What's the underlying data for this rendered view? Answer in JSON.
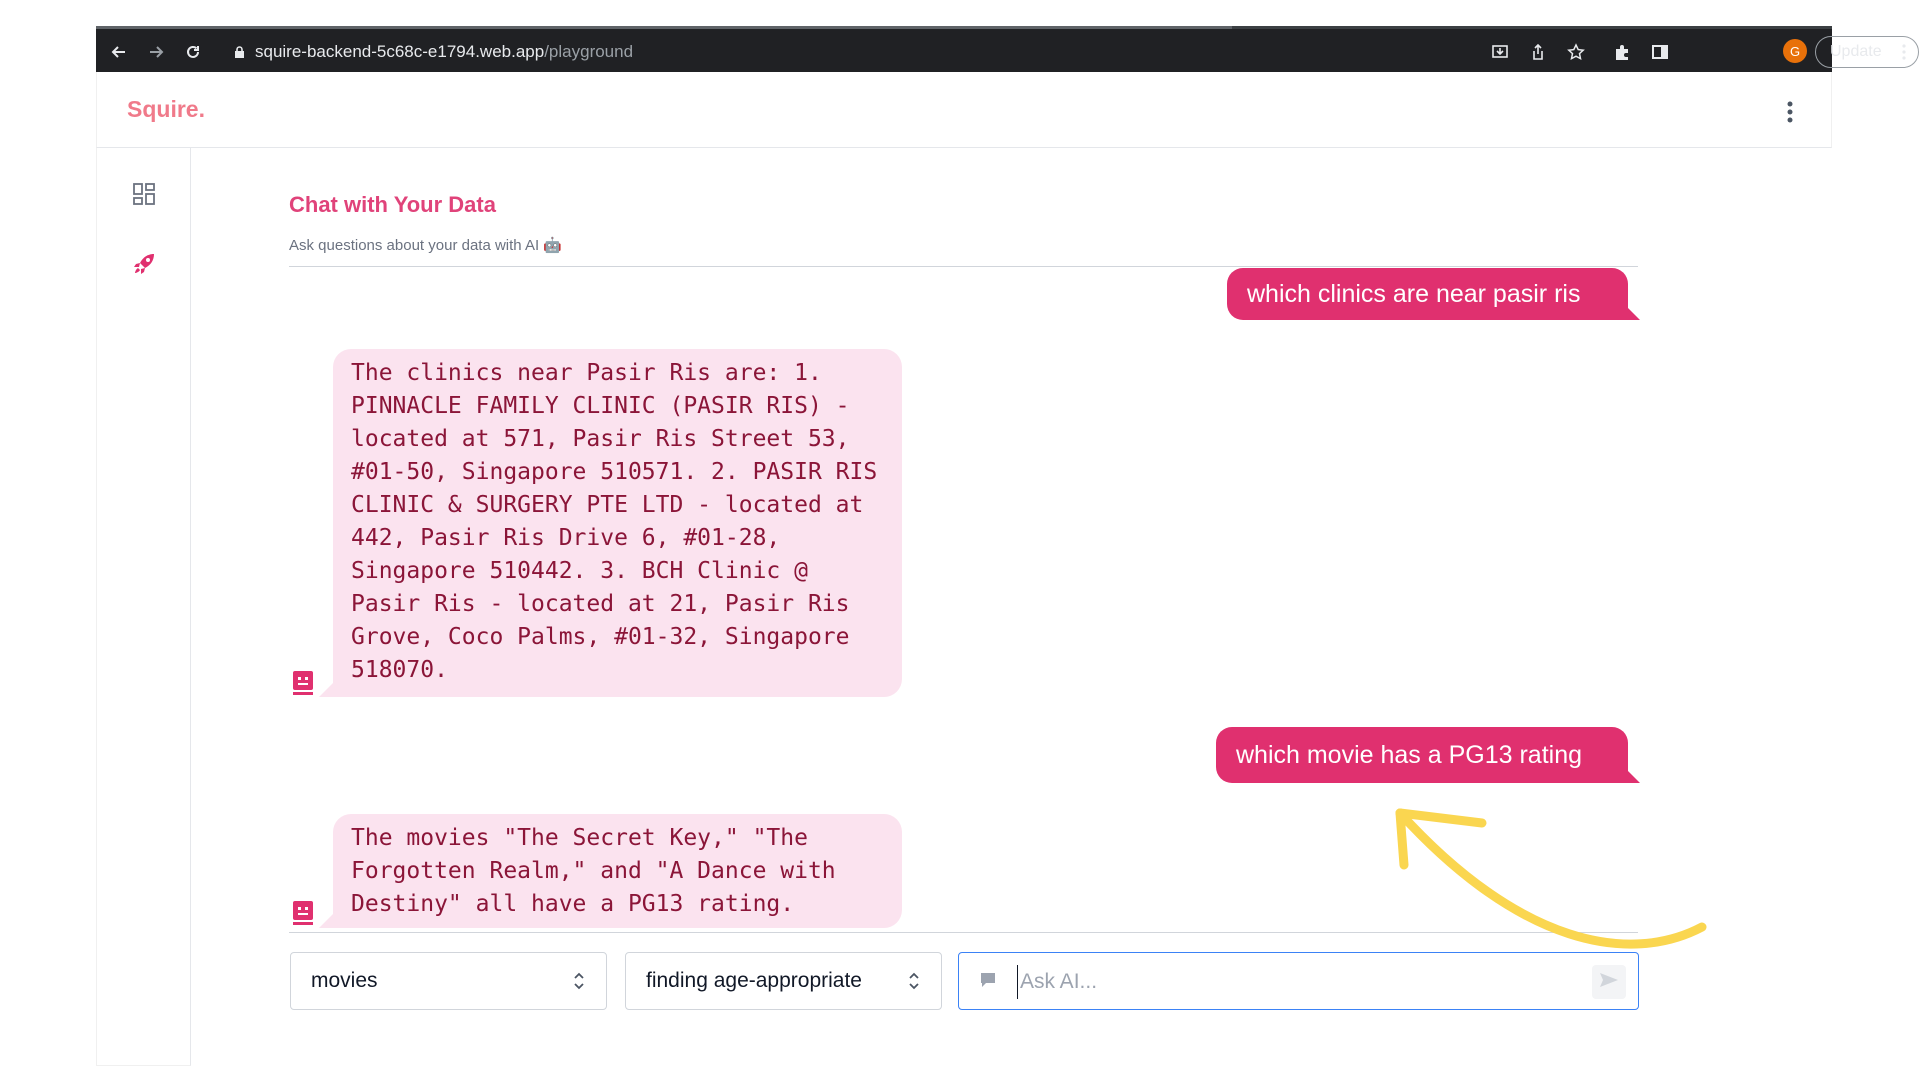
{
  "browser": {
    "url_host": "squire-backend-5c68c-e1794.web.app",
    "url_path": "/playground",
    "profile_initial": "G",
    "update_label": "Update"
  },
  "app": {
    "logo": "Squire.",
    "accent_color": "#e0306f"
  },
  "sidebar": {
    "items": [
      {
        "icon": "dashboard-icon"
      },
      {
        "icon": "rocket-icon"
      }
    ]
  },
  "main": {
    "title": "Chat with Your Data",
    "subtitle": "Ask questions about your data with AI 🤖"
  },
  "messages": [
    {
      "role": "user",
      "text": "which clinics are near pasir ris"
    },
    {
      "role": "ai",
      "text": "The clinics near Pasir Ris are: 1. PINNACLE FAMILY CLINIC (PASIR RIS) - located at 571, Pasir Ris Street 53, #01-50, Singapore 510571. 2. PASIR RIS CLINIC & SURGERY PTE LTD - located at 442, Pasir Ris Drive 6, #01-28, Singapore 510442. 3. BCH Clinic @ Pasir Ris - located at 21, Pasir Ris Grove, Coco Palms, #01-32, Singapore 518070."
    },
    {
      "role": "user",
      "text": "which movie has a PG13 rating"
    },
    {
      "role": "ai",
      "text": "The movies \"The Secret Key,\" \"The Forgotten Realm,\" and \"A Dance with Destiny\" all have a PG13 rating."
    }
  ],
  "controls": {
    "dataset_select": "movies",
    "prompt_select": "finding age-appropriate",
    "ask_placeholder": "Ask AI..."
  }
}
